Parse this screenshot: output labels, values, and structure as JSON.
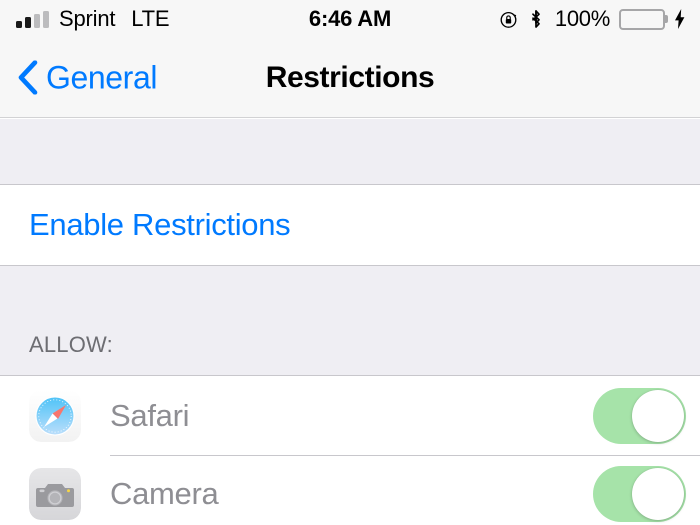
{
  "status_bar": {
    "signal_icon": "signal-bars-icon",
    "signal_bars_filled": 2,
    "signal_bars_total": 4,
    "carrier": "Sprint",
    "network_type": "LTE",
    "time": "6:46 AM",
    "rotation_lock_icon": "rotation-lock-icon",
    "bluetooth_icon": "bluetooth-icon",
    "battery_percent": "100%",
    "battery_icon": "battery-icon",
    "battery_color": "#4CD964",
    "charging_icon": "lightning-bolt-icon"
  },
  "nav_bar": {
    "back_icon": "chevron-left-icon",
    "back_label": "General",
    "title": "Restrictions",
    "accent_color": "#007AFF"
  },
  "content": {
    "enable_restrictions": {
      "label": "Enable Restrictions",
      "color": "#007AFF"
    },
    "allow_section": {
      "header": "ALLOW:",
      "rows": [
        {
          "label": "Safari",
          "icon": "safari-icon",
          "toggle_state": "on",
          "toggle_color": "#A6E3A9"
        },
        {
          "label": "Camera",
          "icon": "camera-icon",
          "toggle_state": "on",
          "toggle_color": "#A6E3A9"
        }
      ]
    }
  }
}
